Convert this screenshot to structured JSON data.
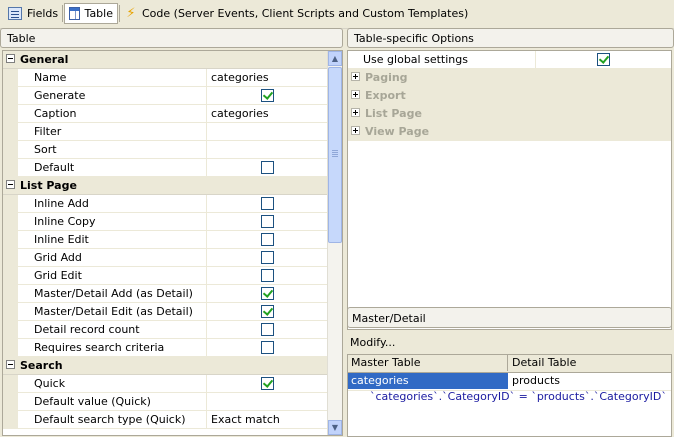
{
  "toolbar": {
    "tabs": [
      {
        "label": "Fields",
        "icon": "fields-icon"
      },
      {
        "label": "Table",
        "icon": "table-icon",
        "active": true
      },
      {
        "label": "Code (Server Events, Client Scripts and Custom Templates)",
        "icon": "lightning-icon"
      }
    ]
  },
  "left_panel": {
    "title": "Table",
    "sections": [
      {
        "label": "General",
        "rows": [
          {
            "name": "Name",
            "value": "categories"
          },
          {
            "name": "Generate",
            "checked": true
          },
          {
            "name": "Caption",
            "value": "categories"
          },
          {
            "name": "Filter",
            "value": ""
          },
          {
            "name": "Sort",
            "value": ""
          },
          {
            "name": "Default",
            "checked": false
          }
        ]
      },
      {
        "label": "List Page",
        "rows": [
          {
            "name": "Inline Add",
            "checked": false
          },
          {
            "name": "Inline Copy",
            "checked": false
          },
          {
            "name": "Inline Edit",
            "checked": false
          },
          {
            "name": "Grid Add",
            "checked": false
          },
          {
            "name": "Grid Edit",
            "checked": false
          },
          {
            "name": "Master/Detail Add (as Detail)",
            "checked": true
          },
          {
            "name": "Master/Detail Edit (as Detail)",
            "checked": true
          },
          {
            "name": "Detail record count",
            "checked": false
          },
          {
            "name": "Requires search criteria",
            "checked": false
          }
        ]
      },
      {
        "label": "Search",
        "rows": [
          {
            "name": "Quick",
            "checked": true
          },
          {
            "name": "Default value (Quick)",
            "value": ""
          },
          {
            "name": "Default search type (Quick)",
            "value": "Exact match"
          }
        ]
      }
    ]
  },
  "right_panel": {
    "title": "Table-specific Options",
    "use_global": {
      "label": "Use global settings",
      "checked": true
    },
    "categories": [
      "Paging",
      "Export",
      "List Page",
      "View Page"
    ],
    "master_detail": {
      "title": "Master/Detail",
      "modify_label": "Modify...",
      "col_master": "Master Table",
      "col_detail": "Detail Table",
      "master": "categories",
      "detail": "products",
      "relation": "`categories`.`CategoryID` = `products`.`CategoryID`"
    }
  }
}
